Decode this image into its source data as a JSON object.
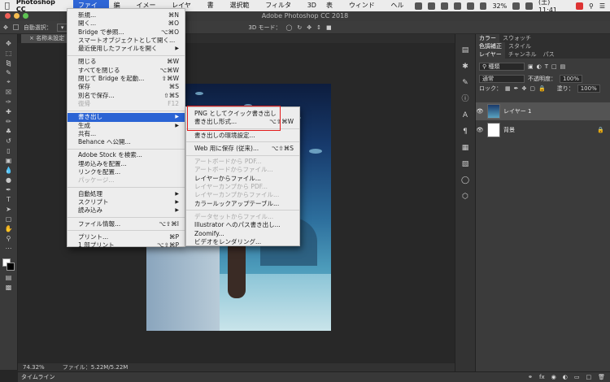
{
  "menubar": {
    "app_name": "Photoshop CC",
    "items": [
      "ファイル",
      "編集",
      "イメージ",
      "レイヤー",
      "書式",
      "選択範囲",
      "フィルター",
      "3D",
      "表示",
      "ウィンドウ",
      "ヘルプ"
    ],
    "active_index": 0,
    "battery": "32%",
    "clock": "(土) 11:41"
  },
  "window": {
    "title": "Adobe Photoshop CC 2018"
  },
  "options_bar": {
    "auto_select_label": "自動選択：",
    "mode_3d": "3D モード："
  },
  "document_tab": {
    "label": "名称未設定 1 @"
  },
  "file_menu": {
    "items": [
      {
        "label": "新規...",
        "shortcut": "⌘N"
      },
      {
        "label": "開く...",
        "shortcut": "⌘O"
      },
      {
        "label": "Bridge で参照...",
        "shortcut": "⌥⌘O"
      },
      {
        "label": "スマートオブジェクトとして開く...",
        "shortcut": ""
      },
      {
        "label": "最近使用したファイルを開く",
        "shortcut": "",
        "submenu": true
      },
      {
        "sep": true
      },
      {
        "label": "閉じる",
        "shortcut": "⌘W"
      },
      {
        "label": "すべてを閉じる",
        "shortcut": "⌥⌘W"
      },
      {
        "label": "閉じて Bridge を起動...",
        "shortcut": "⇧⌘W"
      },
      {
        "label": "保存",
        "shortcut": "⌘S"
      },
      {
        "label": "別名で保存...",
        "shortcut": "⇧⌘S"
      },
      {
        "label": "復帰",
        "shortcut": "F12",
        "disabled": true
      },
      {
        "sep": true
      },
      {
        "label": "書き出し",
        "shortcut": "",
        "submenu": true,
        "highlight": true
      },
      {
        "label": "生成",
        "shortcut": "",
        "submenu": true
      },
      {
        "label": "共有...",
        "shortcut": ""
      },
      {
        "label": "Behance へ公開...",
        "shortcut": ""
      },
      {
        "sep": true
      },
      {
        "label": "Adobe Stock を検索...",
        "shortcut": ""
      },
      {
        "label": "埋め込みを配置...",
        "shortcut": ""
      },
      {
        "label": "リンクを配置...",
        "shortcut": ""
      },
      {
        "label": "パッケージ...",
        "shortcut": "",
        "disabled": true
      },
      {
        "sep": true
      },
      {
        "label": "自動処理",
        "shortcut": "",
        "submenu": true
      },
      {
        "label": "スクリプト",
        "shortcut": "",
        "submenu": true
      },
      {
        "label": "読み込み",
        "shortcut": "",
        "submenu": true
      },
      {
        "sep": true
      },
      {
        "label": "ファイル情報...",
        "shortcut": "⌥⇧⌘I"
      },
      {
        "sep": true
      },
      {
        "label": "プリント...",
        "shortcut": "⌘P"
      },
      {
        "label": "1 部プリント",
        "shortcut": "⌥⇧⌘P"
      }
    ]
  },
  "export_submenu": {
    "items": [
      {
        "label": "PNG としてクイック書き出し",
        "shortcut": ""
      },
      {
        "label": "書き出し形式...",
        "shortcut": "⌥⇧⌘W"
      },
      {
        "sep": true
      },
      {
        "label": "書き出しの環境設定...",
        "shortcut": ""
      },
      {
        "sep": true
      },
      {
        "label": "Web 用に保存 (従来)...",
        "shortcut": "⌥⇧⌘S"
      },
      {
        "sep": true
      },
      {
        "label": "アートボードから PDF...",
        "shortcut": "",
        "disabled": true
      },
      {
        "label": "アートボードからファイル...",
        "shortcut": "",
        "disabled": true
      },
      {
        "label": "レイヤーからファイル...",
        "shortcut": ""
      },
      {
        "label": "レイヤーカンプから PDF...",
        "shortcut": "",
        "disabled": true
      },
      {
        "label": "レイヤーカンプからファイル...",
        "shortcut": "",
        "disabled": true
      },
      {
        "label": "カラールックアップテーブル...",
        "shortcut": ""
      },
      {
        "sep": true
      },
      {
        "label": "データセットからファイル...",
        "shortcut": "",
        "disabled": true
      },
      {
        "label": "Illustrator へのパス書き出し...",
        "shortcut": ""
      },
      {
        "label": "Zoomify...",
        "shortcut": ""
      },
      {
        "label": "ビデオをレンダリング...",
        "shortcut": ""
      }
    ]
  },
  "panels": {
    "tabs_top": [
      "カラー",
      "スウォッチ"
    ],
    "tabs_mid": [
      "色調補正",
      "スタイル"
    ],
    "tabs_layers": [
      "レイヤー",
      "チャンネル",
      "パス"
    ],
    "filter_kind": "種類",
    "blend_mode": "通常",
    "opacity_label": "不透明度：",
    "opacity_value": "100%",
    "lock_label": "ロック：",
    "fill_label": "塗り：",
    "fill_value": "100%",
    "layers": [
      {
        "name": "レイヤー 1",
        "selected": true
      },
      {
        "name": "背景",
        "selected": false
      }
    ]
  },
  "status": {
    "zoom": "74.32%",
    "file_info": "ファイル：5.22M/5.22M"
  },
  "timeline": {
    "label": "タイムライン"
  }
}
